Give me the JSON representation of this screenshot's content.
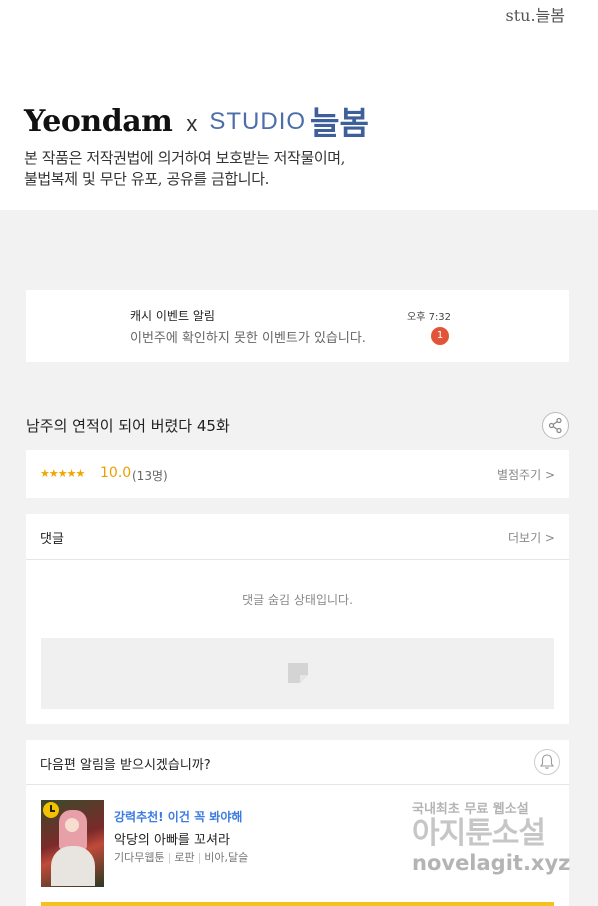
{
  "header": {
    "credit": "stu.늘봄",
    "brand_yeondam": "Yeondam",
    "brand_x": "x",
    "brand_studio": "STUDIO",
    "brand_neulbom": "늘봄",
    "copyright_line1": "본 작품은 저작권법에 의거하여 보호받는 저작물이며,",
    "copyright_line2": "불법복제 및 무단 유포, 공유를 금합니다."
  },
  "notification": {
    "title": "캐시 이벤트 알림",
    "text": "이번주에 확인하지 못한 이벤트가 있습니다.",
    "time": "오후 7:32",
    "badge": "1"
  },
  "episode": {
    "title": "남주의 연적이 되어 버렸다 45화"
  },
  "rating": {
    "stars": "★★★★★",
    "score": "10.0",
    "count": "(13명)",
    "rate_link": "별점주기 >"
  },
  "comments": {
    "title": "댓글",
    "more": "더보기 >",
    "hidden_message": "댓글 숨김 상태입니다."
  },
  "next": {
    "title": "다음편 알림을 받으시겠습니까?",
    "recommend": "강력추천! 이건 꼭 봐야해",
    "name": "악당의 아빠를 꼬셔라",
    "meta": [
      "기다무웹툰",
      "로판",
      "비아,달슬"
    ]
  },
  "watermark": {
    "line1": "국내최초 무료 웹소설",
    "line2": "아지툰소설",
    "line3": "novelagit.xyz"
  },
  "colors": {
    "accent_yellow": "#f4c21c",
    "badge_red": "#e2543a",
    "score_orange": "#e8a200",
    "reco_blue": "#3d7be0",
    "studio_blue": "#3e5f9a"
  }
}
